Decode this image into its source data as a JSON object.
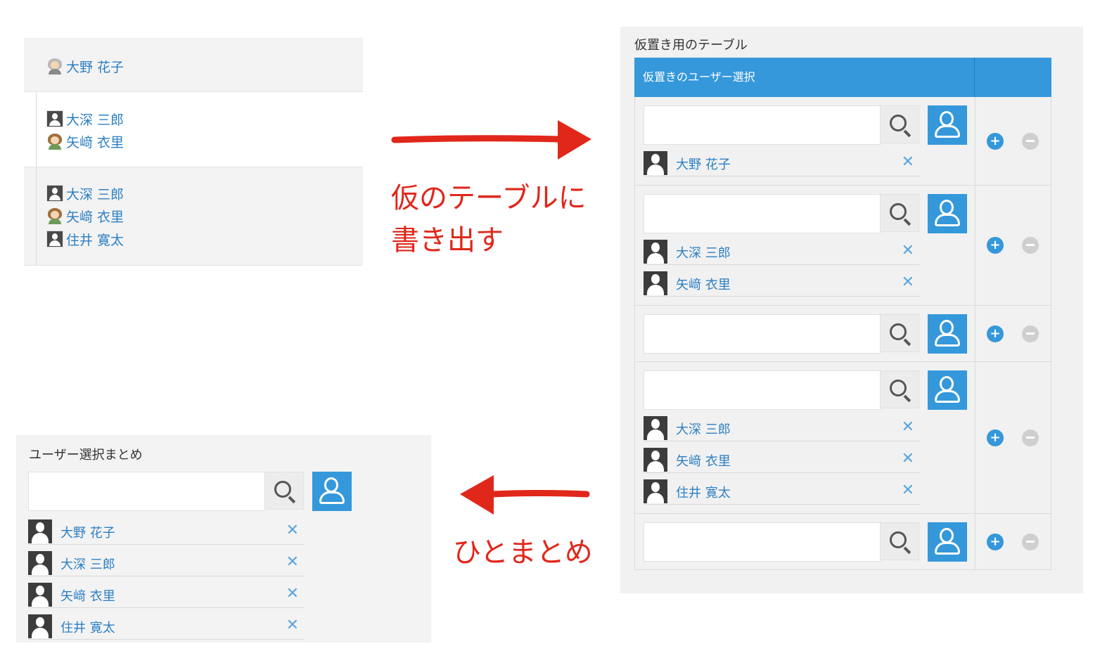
{
  "source_list": {
    "rows": [
      {
        "users": [
          {
            "name": "大野 花子",
            "avatar": "elder-woman-icon"
          }
        ]
      },
      {
        "users": [
          {
            "name": "大深 三郎",
            "avatar": "person-icon"
          },
          {
            "name": "矢﨑 衣里",
            "avatar": "woman-icon"
          }
        ]
      },
      {
        "users": [
          {
            "name": "大深 三郎",
            "avatar": "person-icon"
          },
          {
            "name": "矢﨑 衣里",
            "avatar": "woman-icon"
          },
          {
            "name": "住井 寛太",
            "avatar": "person-icon"
          }
        ]
      }
    ]
  },
  "annotations": {
    "write_out": "仮のテーブルに\n書き出す",
    "write_out_line1": "仮のテーブルに",
    "write_out_line2": "書き出す",
    "merge": "ひとまとめ",
    "arrow_color": "#e0271a"
  },
  "temp_table": {
    "title": "仮置き用のテーブル",
    "column_header": "仮置きのユーザー選択",
    "header_color": "#3498db",
    "rows": [
      {
        "selected": [
          "大野 花子"
        ]
      },
      {
        "selected": [
          "大深 三郎",
          "矢﨑 衣里"
        ]
      },
      {
        "selected": []
      },
      {
        "selected": [
          "大深 三郎",
          "矢﨑 衣里",
          "住井 寛太"
        ]
      },
      {
        "selected": []
      }
    ],
    "add_icon": "+",
    "remove_icon": "−",
    "remove_x": "✕"
  },
  "summary": {
    "title": "ユーザー選択まとめ",
    "selected": [
      "大野 花子",
      "大深 三郎",
      "矢﨑 衣里",
      "住井 寛太"
    ],
    "remove_x": "✕"
  }
}
